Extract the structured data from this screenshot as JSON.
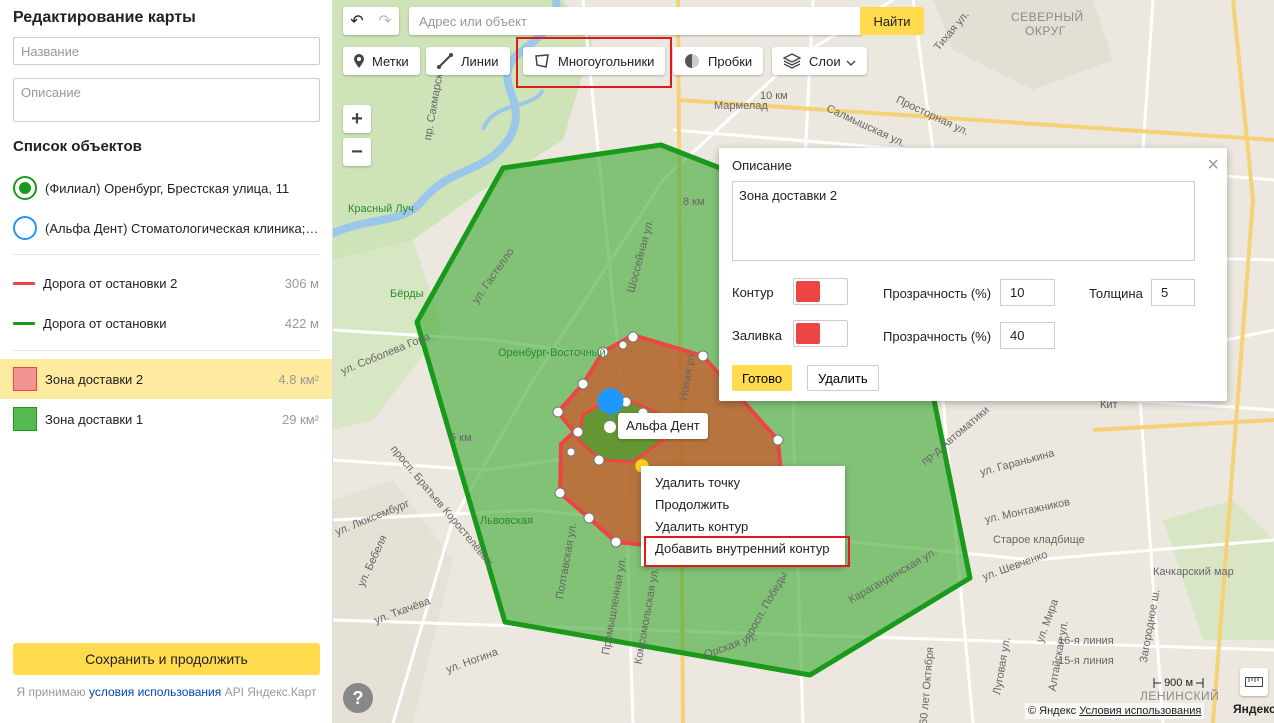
{
  "sidebar": {
    "title": "Редактирование карты",
    "name_placeholder": "Название",
    "description_placeholder": "Описание",
    "objects_title": "Список объектов",
    "points": [
      {
        "label": "(Филиал) Оренбург, Брестская улица, 11",
        "color": "#1a9a1a",
        "filled": true
      },
      {
        "label": "(Альфа Дент) Стоматологическая клиника; г. Оренбург",
        "color": "#1e98ff",
        "filled": false
      }
    ],
    "lines": [
      {
        "label": "Дорога от остановки 2",
        "value": "306 м",
        "color": "#ed4543"
      },
      {
        "label": "Дорога от остановки",
        "value": "422 м",
        "color": "#1a9a1a"
      }
    ],
    "polygons": [
      {
        "label": "Зона доставки 2",
        "value": "4.8 км²",
        "fill": "#f49393",
        "stroke": "#ed4543",
        "selected": true
      },
      {
        "label": "Зона доставки 1",
        "value": "29 км²",
        "fill": "#56b94f",
        "stroke": "#1a9a1a",
        "selected": false
      }
    ],
    "save_label": "Сохранить и продолжить",
    "terms_prefix": "Я принимаю",
    "terms_link": "условия использования",
    "terms_suffix": "API Яндекс.Карт"
  },
  "toolbar": {
    "search_placeholder": "Адрес или объект",
    "search_button": "Найти",
    "marks": "Метки",
    "lines": "Линии",
    "polygons": "Многоугольники",
    "traffic": "Пробки",
    "layers": "Слои"
  },
  "popup": {
    "title": "Описание",
    "description": "Зона доставки 2",
    "contour_label": "Контур",
    "fill_label": "Заливка",
    "opacity_label": "Прозрачность (%)",
    "thickness_label": "Толщина",
    "contour_opacity": "10",
    "fill_opacity": "40",
    "thickness": "5",
    "contour_color": "#ed4543",
    "fill_color": "#ed4543",
    "done_button": "Готово",
    "delete_button": "Удалить"
  },
  "context_menu": {
    "items": [
      "Удалить точку",
      "Продолжить",
      "Удалить контур",
      "Добавить внутренний контур"
    ]
  },
  "map": {
    "marker_label": "Альфа Дент",
    "labels": {
      "north_district_1": "СЕВЕРНЫЙ",
      "north_district_2": "ОКРУГ",
      "lenin_district": "ЛЕНИНСКИЙ",
      "berdy": "Бёрды",
      "krasny_luch": "Красный Луч",
      "orenburg_vost": "Оренбург-Восточный",
      "lvovskaya": "Львовская",
      "marmelad": "Мармелад",
      "km10": "10 км",
      "km8": "8 км",
      "km5": "5 км",
      "kit": "Кит",
      "old_cemetery": "Старое кладбище",
      "kachkar_map": "Качкарский мар",
      "st_sobolev": "ул. Соболева Гора",
      "st_gastello": "ул. Гастелло",
      "pr_bratiev": "просп. Братьев Коростелёвых",
      "st_luxemburg": "ул. Люксембург",
      "st_bebelya": "ул. Бебеля",
      "st_tkacheva": "ул. Ткачёва",
      "st_nogina": "ул. Ногина",
      "st_garanka": "ул. Гаранькина",
      "st_montazhnikov": "ул. Монтажников",
      "st_shevchenko": "ул. Шевченко",
      "st_karaganda": "Карагандинская ул.",
      "st_mira": "ул. Мира",
      "st_16line": "16-я линия",
      "st_15line": "15-я линия",
      "st_lugovaya": "Луговая ул.",
      "st_altai": "Алтайская ул.",
      "st_zagorodnoe": "Загородное ш.",
      "st_salmysh": "Салмышская ул.",
      "st_prostornaya": "Просторная ул.",
      "st_tihaya": "Тихая ул.",
      "st_sakmara": "пр. Сакмарский",
      "st_shosseyn": "Шоссейная ул.",
      "st_avtomatiki": "пр-д Автоматики",
      "st_poltav": "Полтавская ул.",
      "st_komsomol": "Комсомольская ул.",
      "st_promyshl": "Промышленная ул.",
      "st_pobedy": "просп. Победы",
      "st_orskaya": "Орская ул.",
      "st_60let": "60 лет Октября",
      "st_novaya": "Новая ул."
    },
    "scale": "900 м",
    "help": "?",
    "copyright_prefix": "© Яндекс",
    "copyright_link": "Условия использования",
    "logo": "Яндекс"
  }
}
